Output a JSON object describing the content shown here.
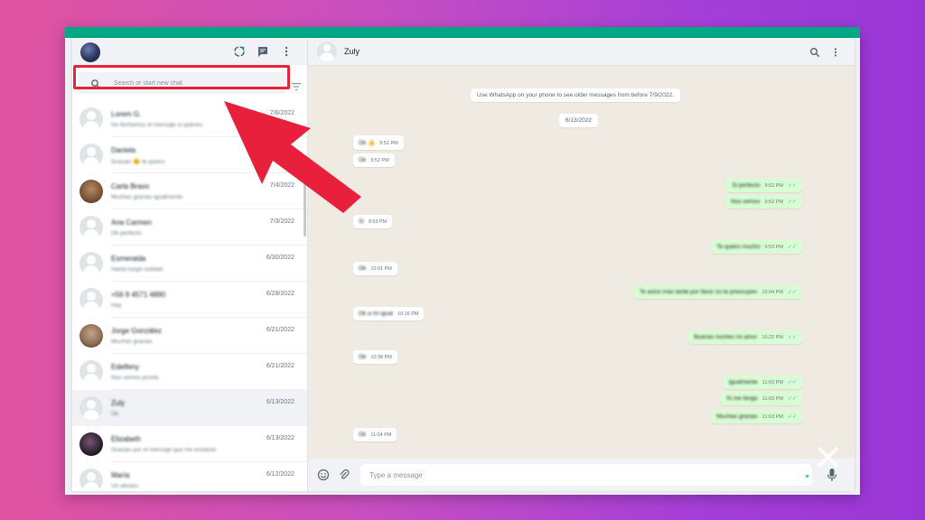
{
  "left_pane": {
    "search": {
      "placeholder": "Search or start new chat"
    },
    "chats": [
      {
        "name": "Lorem G.",
        "preview": "No fechamos el mensaje si quieres",
        "date": "7/6/2022",
        "avatar": "default"
      },
      {
        "name": "Daniela",
        "preview": "Gracias 😊 te quiero",
        "date": "",
        "avatar": "default"
      },
      {
        "name": "Carla Bravo",
        "preview": "Muchas gracias igualmente",
        "date": "7/4/2022",
        "avatar": "photo"
      },
      {
        "name": "Ana Carmen",
        "preview": "Ok perfecto",
        "date": "7/3/2022",
        "avatar": "default"
      },
      {
        "name": "Esmeralda",
        "preview": "Hasta luego cuidate",
        "date": "6/30/2022",
        "avatar": "default"
      },
      {
        "name": "+56 9 4571 4890",
        "preview": "Hey",
        "date": "6/28/2022",
        "avatar": "default"
      },
      {
        "name": "Jorge González",
        "preview": "Muchas gracias",
        "date": "6/21/2022",
        "avatar": "photo2"
      },
      {
        "name": "Edelfeny",
        "preview": "Nos vemos pronto",
        "date": "6/21/2022",
        "avatar": "default"
      },
      {
        "name": "Zuly",
        "preview": "Ok",
        "date": "6/13/2022",
        "avatar": "default",
        "selected": true
      },
      {
        "name": "Elizabeth",
        "preview": "Gracias por el mensaje que me enviaste",
        "date": "6/13/2022",
        "avatar": "photo3"
      },
      {
        "name": "María",
        "preview": "Un abrazo",
        "date": "6/12/2022",
        "avatar": "default"
      }
    ]
  },
  "conversation": {
    "contact_name": "Zuly",
    "notice": "Use WhatsApp on your phone to see older messages from before 7/9/2022.",
    "date_chip": "6/13/2022",
    "messages": [
      {
        "dir": "in",
        "text": "Ok 👍",
        "time": "9:51 PM"
      },
      {
        "dir": "in",
        "text": "Ok",
        "time": "9:52 PM"
      },
      {
        "dir": "out",
        "text": "Si perfecto",
        "time": "9:52 PM"
      },
      {
        "dir": "out",
        "text": "Nos vemos",
        "time": "9:52 PM"
      },
      {
        "dir": "in",
        "text": "Si",
        "time": "9:53 PM"
      },
      {
        "dir": "out",
        "text": "Te quiero mucho",
        "time": "9:53 PM"
      },
      {
        "dir": "in",
        "text": "Ok",
        "time": "10:01 PM"
      },
      {
        "dir": "out",
        "text": "Te aviso mas tarde por favor no te preocupes",
        "time": "10:04 PM"
      },
      {
        "dir": "in",
        "text": "Ok a mi igual",
        "time": "10:16 PM"
      },
      {
        "dir": "out",
        "text": "Buenas noches mi amor",
        "time": "10:22 PM"
      },
      {
        "dir": "in",
        "text": "Ok",
        "time": "10:38 PM"
      },
      {
        "dir": "out",
        "text": "Igualmente",
        "time": "11:03 PM"
      },
      {
        "dir": "out",
        "text": "Si me tengo",
        "time": "11:03 PM"
      },
      {
        "dir": "out",
        "text": "Muchas gracias",
        "time": "11:03 PM"
      },
      {
        "dir": "in",
        "text": "Ok",
        "time": "11:04 PM"
      }
    ],
    "composer_placeholder": "Type a message"
  },
  "colors": {
    "accent": "#00a884",
    "highlight_box": "#e5243a",
    "arrow": "#e8203c",
    "outgoing_bubble": "#d9fdd3"
  },
  "icons": [
    "status-icon",
    "new-chat-icon",
    "menu-icon",
    "search-icon",
    "filter-icon",
    "emoji-icon",
    "attach-icon",
    "mic-icon"
  ]
}
